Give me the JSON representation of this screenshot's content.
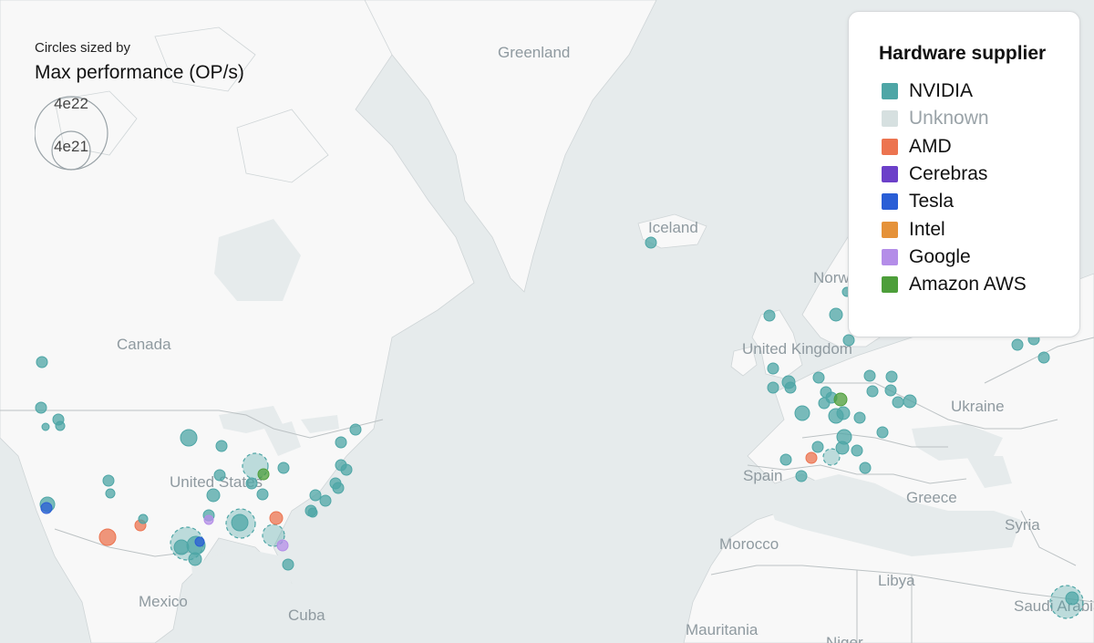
{
  "size_legend": {
    "caption": "Circles sized by",
    "metric": "Max performance (OP/s)",
    "large_value": "4e22",
    "small_value": "4e21"
  },
  "legend": {
    "title": "Hardware supplier",
    "items": [
      {
        "label": "NVIDIA",
        "color": "#4ea6a6",
        "dim": false
      },
      {
        "label": "Unknown",
        "color": "#d6e0e0",
        "dim": true
      },
      {
        "label": "AMD",
        "color": "#ec7450",
        "dim": false
      },
      {
        "label": "Cerebras",
        "color": "#6c40c9",
        "dim": false
      },
      {
        "label": "Tesla",
        "color": "#2a5ed6",
        "dim": false
      },
      {
        "label": "Intel",
        "color": "#e5923a",
        "dim": false
      },
      {
        "label": "Google",
        "color": "#b48de8",
        "dim": false
      },
      {
        "label": "Amazon AWS",
        "color": "#4d9e3a",
        "dim": false
      }
    ]
  },
  "map_labels": [
    "Greenland",
    "Iceland",
    "Canada",
    "United States",
    "Mexico",
    "Cuba",
    "Norway",
    "United Kingdom",
    "Ukraine",
    "Spain",
    "Greece",
    "Morocco",
    "Libya",
    "Syria",
    "Saudi Arabia",
    "Mauritania",
    "Niger"
  ],
  "colors": {
    "water": "#e6ebec",
    "land": "#f8f8f8",
    "border": "#bcc2c4"
  }
}
